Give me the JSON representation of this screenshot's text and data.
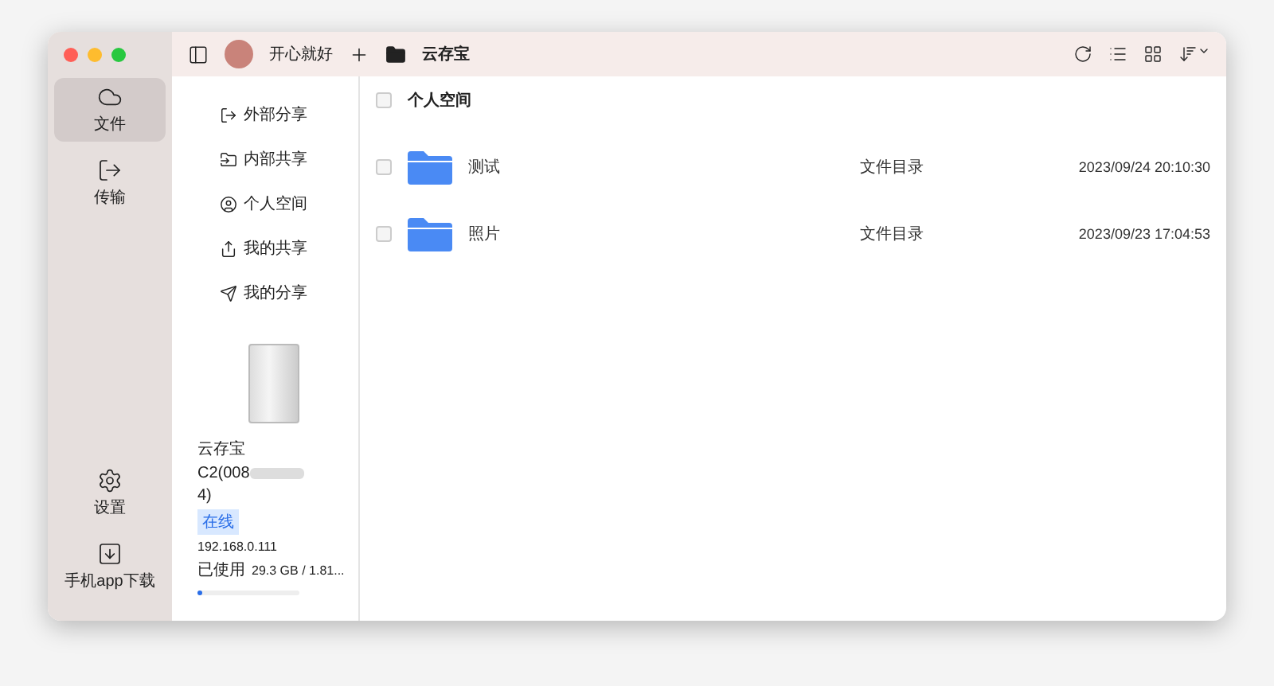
{
  "toolbar": {
    "user": "开心就好",
    "location": "云存宝"
  },
  "rail": [
    {
      "label": "文件",
      "selected": true,
      "kind": "files"
    },
    {
      "label": "传输",
      "selected": false,
      "kind": "transfer"
    }
  ],
  "rail_bottom": [
    {
      "label": "设置",
      "kind": "settings"
    },
    {
      "label": "手机app下载",
      "kind": "download"
    }
  ],
  "shares": [
    {
      "label": "外部分享",
      "kind": "external",
      "selected": false
    },
    {
      "label": "内部共享",
      "kind": "internal",
      "selected": false
    },
    {
      "label": "个人空间",
      "kind": "personal",
      "selected": false
    },
    {
      "label": "我的共享",
      "kind": "myshare",
      "selected": false
    },
    {
      "label": "我的分享",
      "kind": "mysend",
      "selected": false
    }
  ],
  "device": {
    "name": "云存宝",
    "model_start": "C2(008",
    "model_end": "4)",
    "status": "在线",
    "ip": "192.168.0.111",
    "used_label": "已使用",
    "used": "29.3 GB / 1.81...",
    "level": 0.03
  },
  "list": {
    "title": "个人空间",
    "checked": false,
    "rows": [
      {
        "name": "测试",
        "type": "文件目录",
        "date": "2023/09/24 20:10:30",
        "checked": false
      },
      {
        "name": "照片",
        "type": "文件目录",
        "date": "2023/09/23 17:04:53",
        "checked": false
      }
    ]
  }
}
